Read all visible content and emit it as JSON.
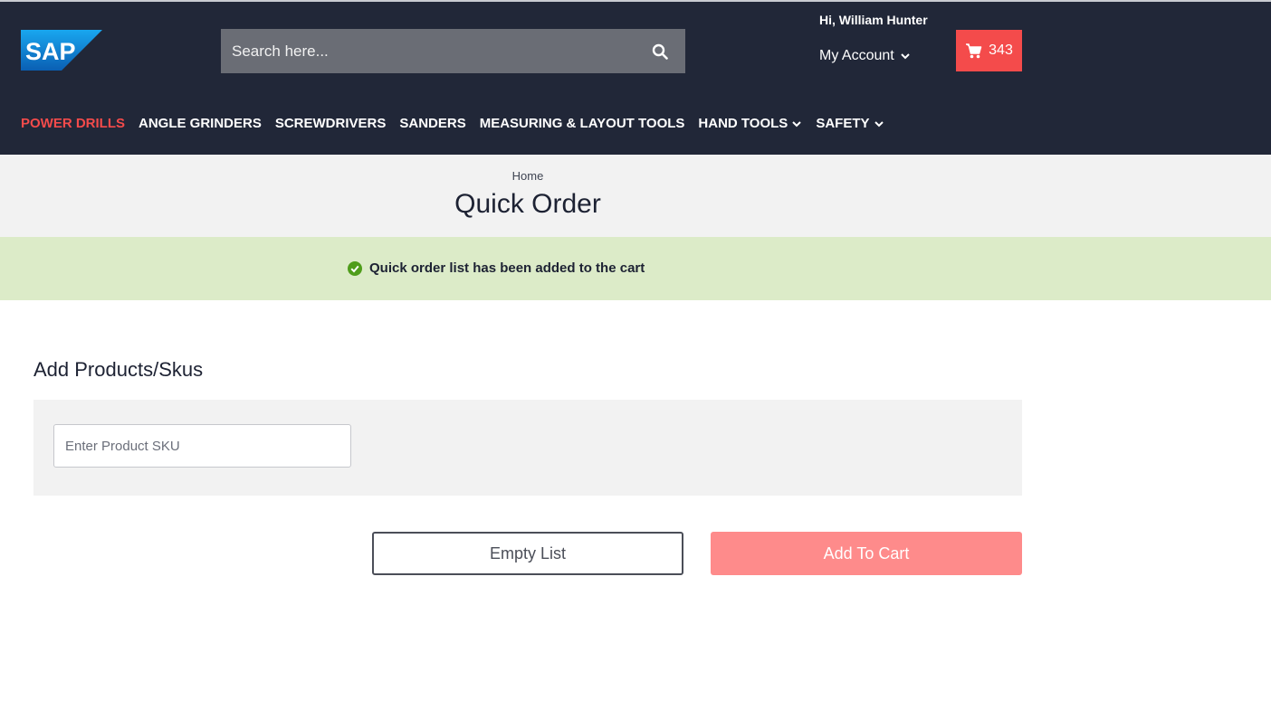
{
  "header": {
    "logo_text": "SAP",
    "search_placeholder": "Search here...",
    "greeting": "Hi, William Hunter",
    "account_label": "My Account",
    "cart_count": "343"
  },
  "nav": {
    "items": [
      {
        "label": "POWER DRILLS",
        "active": true
      },
      {
        "label": "ANGLE GRINDERS"
      },
      {
        "label": "SCREWDRIVERS"
      },
      {
        "label": "SANDERS"
      },
      {
        "label": "MEASURING & LAYOUT TOOLS"
      },
      {
        "label": "HAND TOOLS",
        "dropdown": true
      },
      {
        "label": "SAFETY",
        "dropdown": true
      }
    ]
  },
  "page": {
    "breadcrumb": "Home",
    "title": "Quick Order"
  },
  "alert": {
    "message": "Quick order list has been added to the cart"
  },
  "quick_order": {
    "section_title": "Add Products/Skus",
    "sku_placeholder": "Enter Product SKU",
    "empty_button": "Empty List",
    "add_button": "Add To Cart"
  },
  "colors": {
    "header_bg": "#212738",
    "accent": "#f44b4b",
    "add_button_bg": "#fe8b8b",
    "success_bg": "#dcebc8",
    "success_icon": "#4f9d1b"
  }
}
